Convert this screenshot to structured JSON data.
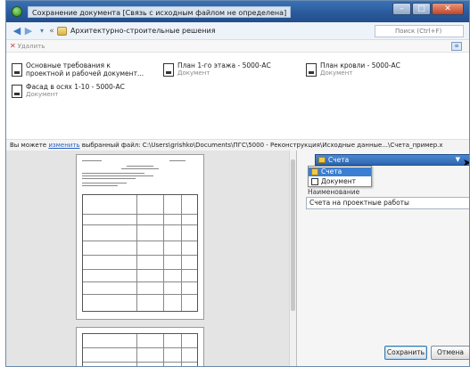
{
  "window": {
    "title": "Сохранение документа [Связь с исходным файлом не определена]",
    "controls": {
      "minimize": "–",
      "maximize": "□",
      "close": "✕"
    }
  },
  "nav": {
    "back": "◀",
    "forward": "▶",
    "history": "▾",
    "chevrons": "«",
    "breadcrumb": "Архитектурно-строительные решения",
    "search_placeholder": "Поиск (Ctrl+F)"
  },
  "toolbar": {
    "delete_label": "Удалить",
    "delete_glyph": "✕",
    "view_glyph": "≡"
  },
  "files": [
    {
      "name_line1": "Основные требования к",
      "name_line2": "проектной и рабочей документ...",
      "type": ""
    },
    {
      "name_line1": "План 1-го этажа - 5000-АС",
      "name_line2": "",
      "type": "Документ"
    },
    {
      "name_line1": "План кровли - 5000-АС",
      "name_line2": "",
      "type": "Документ"
    },
    {
      "name_line1": "Фасад в осях 1-10 - 5000-АС",
      "name_line2": "",
      "type": "Документ"
    }
  ],
  "infobar": {
    "prefix": "Вы можете ",
    "link": "изменить",
    "suffix": " выбранный файл:   C:\\Users\\grishko\\Documents\\ПГС\\5000 - Реконструкция\\Исходные данные...\\Счета_пример.x"
  },
  "form": {
    "folder_value": "Счета",
    "dropdown_options": [
      "Счета",
      "Документ"
    ],
    "name_label": "Наименование",
    "name_value": "Счета на проектные работы",
    "save_label": "Сохранить",
    "cancel_label": "Отмена"
  },
  "colors": {
    "titlebar": "#2a5a9c",
    "selection": "#3b7fd4",
    "link": "#2a62c2"
  }
}
